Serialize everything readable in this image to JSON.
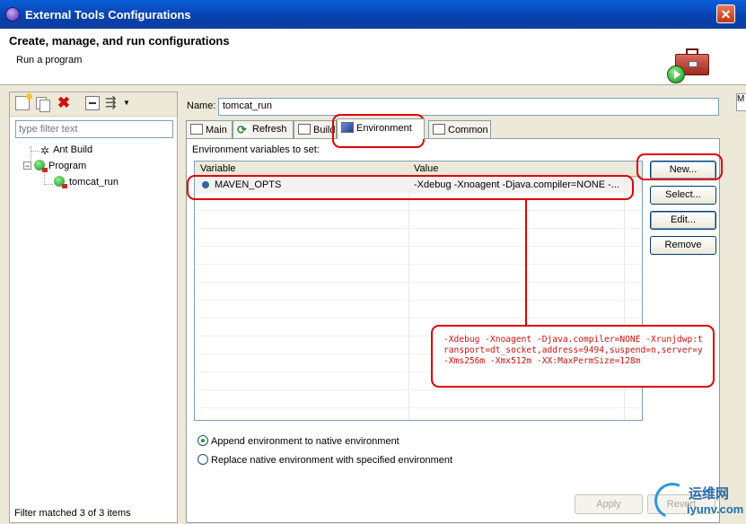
{
  "window": {
    "title": "External Tools Configurations",
    "close_glyph": "✕"
  },
  "header": {
    "title": "Create, manage, and run configurations",
    "subtitle": "Run a program",
    "edge_text": "M"
  },
  "left_pane": {
    "toolbar": [
      "new-launch-config-icon",
      "duplicate-icon",
      "delete-icon",
      "collapse-all-icon",
      "filter-icon"
    ],
    "filter_placeholder": "type filter text",
    "tree": [
      {
        "label": "Ant Build",
        "icon": "ant-icon",
        "level": 0,
        "expandable": false
      },
      {
        "label": "Program",
        "icon": "program-icon",
        "level": 0,
        "expandable": true,
        "expanded": true
      },
      {
        "label": "tomcat_run",
        "icon": "program-config-icon",
        "level": 1,
        "selected": true
      }
    ],
    "status": "Filter matched 3 of 3 items"
  },
  "config": {
    "name_label": "Name:",
    "name_value": "tomcat_run",
    "tabs": [
      {
        "label": "Main",
        "icon": "main-tab-icon"
      },
      {
        "label": "Refresh",
        "icon": "refresh-icon"
      },
      {
        "label": "Build",
        "icon": "build-icon"
      },
      {
        "label": "Environment",
        "icon": "environment-icon",
        "active": true
      },
      {
        "label": "Common",
        "icon": "common-icon"
      }
    ],
    "env_label": "Environment variables to set:",
    "columns": [
      "Variable",
      "Value"
    ],
    "rows": [
      {
        "variable": "MAVEN_OPTS",
        "value": "-Xdebug -Xnoagent -Djava.compiler=NONE -..."
      }
    ],
    "buttons": {
      "new": "New...",
      "select": "Select...",
      "edit": "Edit...",
      "remove": "Remove"
    },
    "radios": [
      {
        "label": "Append environment to native environment",
        "checked": true
      },
      {
        "label": "Replace native environment with specified environment",
        "checked": false
      }
    ],
    "apply": "Apply",
    "revert": "Revert"
  },
  "annotation": {
    "note": "-Xdebug -Xnoagent -Djava.compiler=NONE -Xrunjdwp:transport=dt_socket,address=9494,suspend=n,server=y -Xms256m -Xmx512m -XX:MaxPermSize=128m",
    "color": "#e00000"
  },
  "watermark": {
    "cn": "运维网",
    "url": "iyunv.com"
  },
  "colors": {
    "titlebar": "#0842b0",
    "dialog_bg": "#ece9d8",
    "annotation": "#e00000"
  }
}
